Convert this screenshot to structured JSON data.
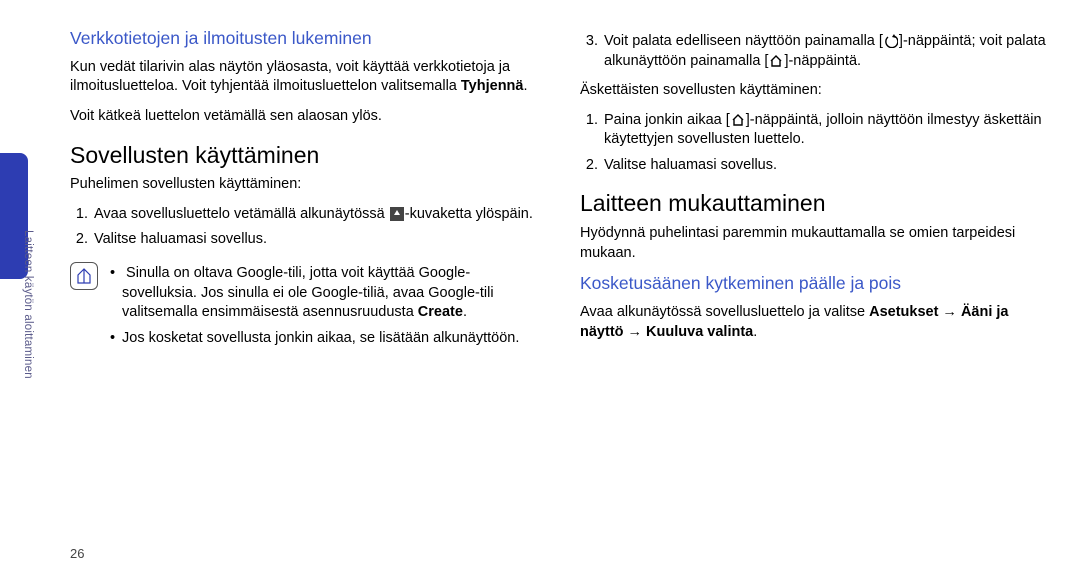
{
  "side_label": "Laitteen käytön aloittaminen",
  "page_number": "26",
  "col1": {
    "h_blue1": "Verkkotietojen ja ilmoitusten lukeminen",
    "p1a": "Kun vedät tilarivin alas näytön yläosasta, voit käyttää verkkotietoja ja ilmoitusluetteloa. Voit tyhjentää ilmoitusluettelon valitsemalla ",
    "p1b_bold": "Tyhjennä",
    "p1c": ".",
    "p2": "Voit kätkeä luettelon vetämällä sen alaosan ylös.",
    "h_sect1": "Sovellusten käyttäminen",
    "p3": "Puhelimen sovellusten käyttäminen:",
    "ol1_li1_a": "Avaa sovellusluettelo vetämällä alkunäytössä ",
    "ol1_li1_b": "-kuvaketta ylöspäin.",
    "ol1_li2": "Valitse haluamasi sovellus.",
    "note_b1a": "Sinulla on oltava Google-tili, jotta voit käyttää Google-sovelluksia. Jos sinulla ei ole Google-tiliä, avaa Google-tili valitsemalla ensimmäisestä asennusruudusta ",
    "note_b1b_bold": "Create",
    "note_b1c": ".",
    "note_b2": "Jos kosketat sovellusta jonkin aikaa, se lisätään alkunäyttöön."
  },
  "col2": {
    "ol2_li3_a": "Voit palata edelliseen näyttöön painamalla [",
    "ol2_li3_b": "]-näppäintä; voit palata alkunäyttöön painamalla [",
    "ol2_li3_c": "]-näppäintä.",
    "p4": "Äskettäisten sovellusten käyttäminen:",
    "ol3_li1_a": "Paina jonkin aikaa [",
    "ol3_li1_b": "]-näppäintä, jolloin näyttöön ilmestyy äskettäin käytettyjen sovellusten luettelo.",
    "ol3_li2": "Valitse haluamasi sovellus.",
    "h_sect2": "Laitteen mukauttaminen",
    "p5": "Hyödynnä puhelintasi paremmin mukauttamalla se omien tarpeidesi mukaan.",
    "h_blue2": "Kosketusäänen kytkeminen päälle ja pois",
    "p6a": "Avaa alkunäytössä sovellusluettelo ja valitse ",
    "p6b_bold": "Asetukset → Ääni ja näyttö → Kuuluva valinta",
    "p6c": "."
  }
}
